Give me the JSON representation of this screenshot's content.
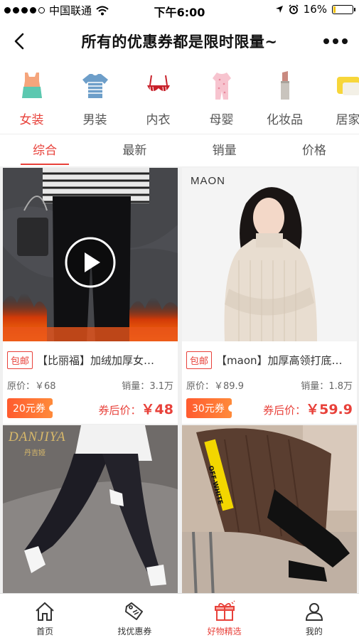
{
  "status": {
    "carrier": "中国联通",
    "time": "下午6:00",
    "battery": "16%"
  },
  "nav": {
    "title": "所有的优惠券都是限时限量~"
  },
  "categories": [
    {
      "label": "女装",
      "icon": "tank-top-icon"
    },
    {
      "label": "男装",
      "icon": "tshirt-icon"
    },
    {
      "label": "内衣",
      "icon": "bra-icon"
    },
    {
      "label": "母婴",
      "icon": "baby-onesie-icon"
    },
    {
      "label": "化妆品",
      "icon": "lipstick-icon"
    },
    {
      "label": "居家",
      "icon": "pillow-icon"
    }
  ],
  "sorts": [
    "综合",
    "最新",
    "销量",
    "价格"
  ],
  "products": [
    {
      "badge": "包邮",
      "name": "【比丽福】加绒加厚女…",
      "original_label": "原价：",
      "original_price": "￥68",
      "sales_label": "销量：",
      "sales": "3.1万",
      "coupon": "20元券",
      "after_label": "券后价：",
      "after_price": "￥48"
    },
    {
      "brand": "MAON",
      "badge": "包邮",
      "name": "【maon】加厚高领打底…",
      "original_label": "原价：",
      "original_price": "￥89.9",
      "sales_label": "销量：",
      "sales": "1.8万",
      "coupon": "30元券",
      "after_label": "券后价：",
      "after_price": "￥59.9"
    },
    {
      "brand": "DANJIYA",
      "brand_sub": "丹吉娅"
    },
    {
      "strap_text": "OFF-WHITE"
    }
  ],
  "tabbar": [
    {
      "label": "首页",
      "icon": "home-icon"
    },
    {
      "label": "找优惠券",
      "icon": "coupon-tag-icon"
    },
    {
      "label": "好物精选",
      "icon": "gift-icon"
    },
    {
      "label": "我的",
      "icon": "user-icon"
    }
  ],
  "colors": {
    "accent": "#e8413a",
    "coupon": "#ff6a33"
  }
}
